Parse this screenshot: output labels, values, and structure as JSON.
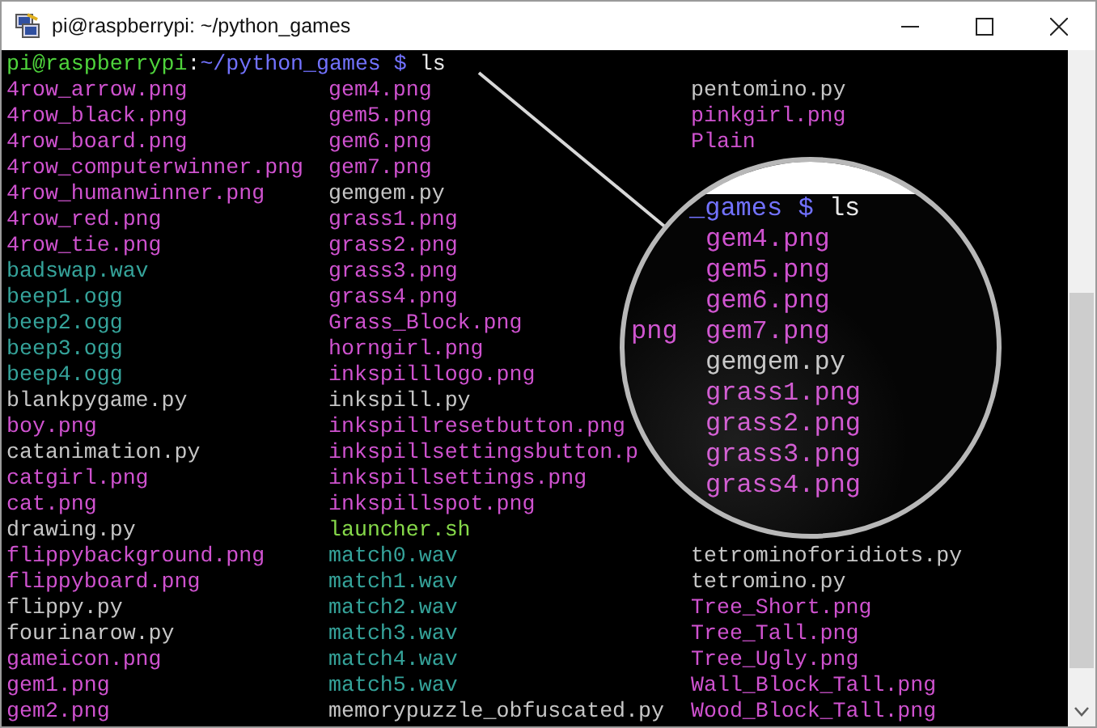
{
  "window": {
    "title": "pi@raspberrypi: ~/python_games"
  },
  "terminal": {
    "prompt": {
      "user_host": "pi@raspberrypi",
      "separator": ":",
      "path": "~/python_games",
      "symbol": "$",
      "command": "ls"
    },
    "rows": [
      {
        "cells": [
          {
            "name": "4row_arrow.png",
            "kind": "image"
          },
          {
            "name": "gem4.png",
            "kind": "image"
          },
          {
            "name": "pentomino.py",
            "kind": "python"
          }
        ]
      },
      {
        "cells": [
          {
            "name": "4row_black.png",
            "kind": "image"
          },
          {
            "name": "gem5.png",
            "kind": "image"
          },
          {
            "name": "pinkgirl.png",
            "kind": "image"
          }
        ]
      },
      {
        "cells": [
          {
            "name": "4row_board.png",
            "kind": "image"
          },
          {
            "name": "gem6.png",
            "kind": "image"
          },
          {
            "name": "Plain",
            "kind": "image"
          }
        ]
      },
      {
        "cells": [
          {
            "name": "4row_computerwinner.png",
            "kind": "image"
          },
          {
            "name": "gem7.png",
            "kind": "image"
          }
        ]
      },
      {
        "cells": [
          {
            "name": "4row_humanwinner.png",
            "kind": "image"
          },
          {
            "name": "gemgem.py",
            "kind": "python"
          }
        ]
      },
      {
        "cells": [
          {
            "name": "4row_red.png",
            "kind": "image"
          },
          {
            "name": "grass1.png",
            "kind": "image"
          }
        ]
      },
      {
        "cells": [
          {
            "name": "4row_tie.png",
            "kind": "image"
          },
          {
            "name": "grass2.png",
            "kind": "image"
          }
        ]
      },
      {
        "cells": [
          {
            "name": "badswap.wav",
            "kind": "audio"
          },
          {
            "name": "grass3.png",
            "kind": "image"
          }
        ]
      },
      {
        "cells": [
          {
            "name": "beep1.ogg",
            "kind": "audio"
          },
          {
            "name": "grass4.png",
            "kind": "image"
          }
        ]
      },
      {
        "cells": [
          {
            "name": "beep2.ogg",
            "kind": "audio"
          },
          {
            "name": "Grass_Block.png",
            "kind": "image"
          }
        ]
      },
      {
        "cells": [
          {
            "name": "beep3.ogg",
            "kind": "audio"
          },
          {
            "name": "horngirl.png",
            "kind": "image"
          }
        ]
      },
      {
        "cells": [
          {
            "name": "beep4.ogg",
            "kind": "audio"
          },
          {
            "name": "inkspilllogo.png",
            "kind": "image"
          }
        ]
      },
      {
        "cells": [
          {
            "name": "blankpygame.py",
            "kind": "python"
          },
          {
            "name": "inkspill.py",
            "kind": "python"
          }
        ]
      },
      {
        "cells": [
          {
            "name": "boy.png",
            "kind": "image"
          },
          {
            "name": "inkspillresetbutton.png",
            "kind": "image"
          }
        ]
      },
      {
        "cells": [
          {
            "name": "catanimation.py",
            "kind": "python"
          },
          {
            "name": "inkspillsettingsbutton.p",
            "kind": "image"
          }
        ]
      },
      {
        "cells": [
          {
            "name": "catgirl.png",
            "kind": "image"
          },
          {
            "name": "inkspillsettings.png",
            "kind": "image"
          }
        ]
      },
      {
        "cells": [
          {
            "name": "cat.png",
            "kind": "image"
          },
          {
            "name": "inkspillspot.png",
            "kind": "image"
          }
        ]
      },
      {
        "cells": [
          {
            "name": "drawing.py",
            "kind": "python"
          },
          {
            "name": "launcher.sh",
            "kind": "script"
          }
        ]
      },
      {
        "cells": [
          {
            "name": "flippybackground.png",
            "kind": "image"
          },
          {
            "name": "match0.wav",
            "kind": "audio"
          },
          {
            "name": "tetrominoforidiots.py",
            "kind": "python"
          }
        ]
      },
      {
        "cells": [
          {
            "name": "flippyboard.png",
            "kind": "image"
          },
          {
            "name": "match1.wav",
            "kind": "audio"
          },
          {
            "name": "tetromino.py",
            "kind": "python"
          }
        ]
      },
      {
        "cells": [
          {
            "name": "flippy.py",
            "kind": "python"
          },
          {
            "name": "match2.wav",
            "kind": "audio"
          },
          {
            "name": "Tree_Short.png",
            "kind": "image"
          }
        ]
      },
      {
        "cells": [
          {
            "name": "fourinarow.py",
            "kind": "python"
          },
          {
            "name": "match3.wav",
            "kind": "audio"
          },
          {
            "name": "Tree_Tall.png",
            "kind": "image"
          }
        ]
      },
      {
        "cells": [
          {
            "name": "gameicon.png",
            "kind": "image"
          },
          {
            "name": "match4.wav",
            "kind": "audio"
          },
          {
            "name": "Tree_Ugly.png",
            "kind": "image"
          }
        ]
      },
      {
        "cells": [
          {
            "name": "gem1.png",
            "kind": "image"
          },
          {
            "name": "match5.wav",
            "kind": "audio"
          },
          {
            "name": "Wall_Block_Tall.png",
            "kind": "image"
          }
        ]
      },
      {
        "cells": [
          {
            "name": "gem2.png",
            "kind": "image"
          },
          {
            "name": "memorypuzzle_obfuscated.py",
            "kind": "python"
          },
          {
            "name": "Wood_Block_Tall.png",
            "kind": "image"
          }
        ]
      }
    ]
  },
  "magnifier": {
    "prompt": {
      "path": "_games",
      "symbol": "$",
      "command": "ls"
    },
    "rows": [
      {
        "entry": {
          "name": "gem4.png",
          "kind": "image"
        }
      },
      {
        "entry": {
          "name": "gem5.png",
          "kind": "image"
        }
      },
      {
        "entry": {
          "name": "gem6.png",
          "kind": "image"
        }
      },
      {
        "left": {
          "name": "png",
          "kind": "image"
        },
        "entry": {
          "name": "gem7.png",
          "kind": "image"
        }
      },
      {
        "entry": {
          "name": "gemgem.py",
          "kind": "python"
        }
      },
      {
        "entry": {
          "name": "grass1.png",
          "kind": "image"
        }
      },
      {
        "entry": {
          "name": "grass2.png",
          "kind": "image"
        }
      },
      {
        "entry": {
          "name": "grass3.png",
          "kind": "image"
        }
      },
      {
        "entry": {
          "name": "grass4.png",
          "kind": "image"
        }
      }
    ]
  }
}
